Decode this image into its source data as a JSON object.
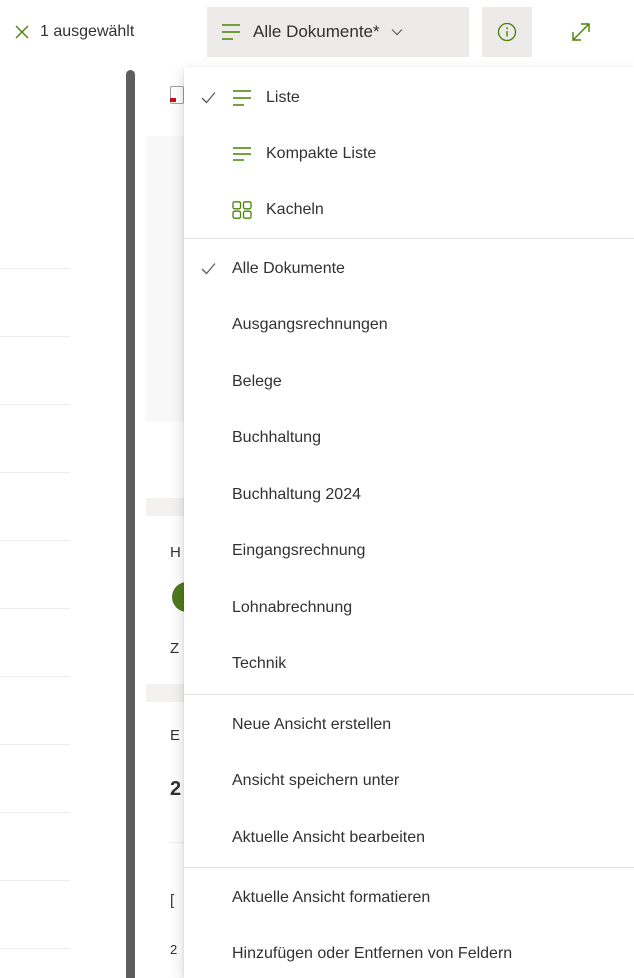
{
  "toolbar": {
    "selection_text": "1 ausgewählt",
    "current_view": "Alle Dokumente*"
  },
  "colors": {
    "accent": "#498205",
    "text": "#323130",
    "button_bg": "#edebe9",
    "scrollbar": "#605e5c"
  },
  "icons": {
    "deselect": "close-icon",
    "view": "list-lines-icon",
    "dropdown": "chevron-down-icon",
    "info": "info-icon",
    "expand": "expand-icon"
  },
  "background": {
    "peek_letters": [
      "H",
      "Z",
      "E",
      "2",
      "[",
      "2"
    ]
  },
  "menu": {
    "layout_options": [
      {
        "label": "Liste",
        "checked": true,
        "icon": "list-lines-icon"
      },
      {
        "label": "Kompakte Liste",
        "checked": false,
        "icon": "compact-list-icon"
      },
      {
        "label": "Kacheln",
        "checked": false,
        "icon": "tiles-icon"
      }
    ],
    "views": [
      {
        "label": "Alle Dokumente",
        "checked": true
      },
      {
        "label": "Ausgangsrechnungen",
        "checked": false
      },
      {
        "label": "Belege",
        "checked": false
      },
      {
        "label": "Buchhaltung",
        "checked": false
      },
      {
        "label": "Buchhaltung 2024",
        "checked": false
      },
      {
        "label": "Eingangsrechnung",
        "checked": false
      },
      {
        "label": "Lohnabrechnung",
        "checked": false
      },
      {
        "label": "Technik",
        "checked": false
      }
    ],
    "view_actions": [
      {
        "label": "Neue Ansicht erstellen"
      },
      {
        "label": "Ansicht speichern unter"
      },
      {
        "label": "Aktuelle Ansicht bearbeiten"
      }
    ],
    "format_actions": [
      {
        "label": "Aktuelle Ansicht formatieren"
      },
      {
        "label": "Hinzufügen oder Entfernen von Feldern"
      }
    ]
  }
}
